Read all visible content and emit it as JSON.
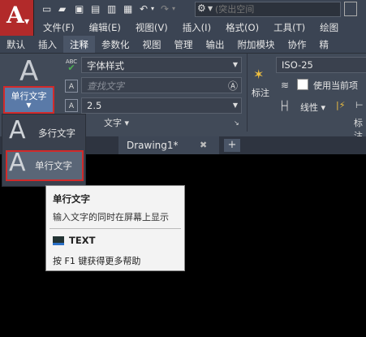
{
  "app": {
    "logo_letter": "A"
  },
  "search": {
    "placeholder": "(突出空间"
  },
  "menu": [
    "文件(F)",
    "编辑(E)",
    "视图(V)",
    "插入(I)",
    "格式(O)",
    "工具(T)",
    "绘图"
  ],
  "ribbon_tabs": [
    {
      "label": "默认",
      "active": false
    },
    {
      "label": "插入",
      "active": false
    },
    {
      "label": "注释",
      "active": true
    },
    {
      "label": "参数化",
      "active": false
    },
    {
      "label": "视图",
      "active": false
    },
    {
      "label": "管理",
      "active": false
    },
    {
      "label": "输出",
      "active": false
    },
    {
      "label": "附加模块",
      "active": false
    },
    {
      "label": "协作",
      "active": false
    },
    {
      "label": "精",
      "active": false
    }
  ],
  "text_panel": {
    "big_button_label": "单行文字",
    "style_value": "字体样式",
    "find_placeholder": "查找文字",
    "height_value": "2.5",
    "panel_title": "文字",
    "abc_label": "ABC"
  },
  "dim_panel": {
    "style_value": "ISO-25",
    "layer_value": "使用当前项",
    "linear_label": "线性",
    "dim_button_label": "标注",
    "panel_title_partial": "标注"
  },
  "doc_tabs": {
    "active": "Drawing1*",
    "close": "✖",
    "plus": "+"
  },
  "dropdown": {
    "items": [
      {
        "label": "多行文字",
        "highlighted": false
      },
      {
        "label": "单行文字",
        "highlighted": true
      }
    ]
  },
  "tooltip": {
    "title": "单行文字",
    "description": "输入文字的同时在屏幕上显示",
    "command": "TEXT",
    "help": "按 F1 键获得更多帮助"
  },
  "colors": {
    "highlight_border": "#d22a2a",
    "ribbon_bg": "#414a58",
    "app_red": "#b22a2a"
  }
}
